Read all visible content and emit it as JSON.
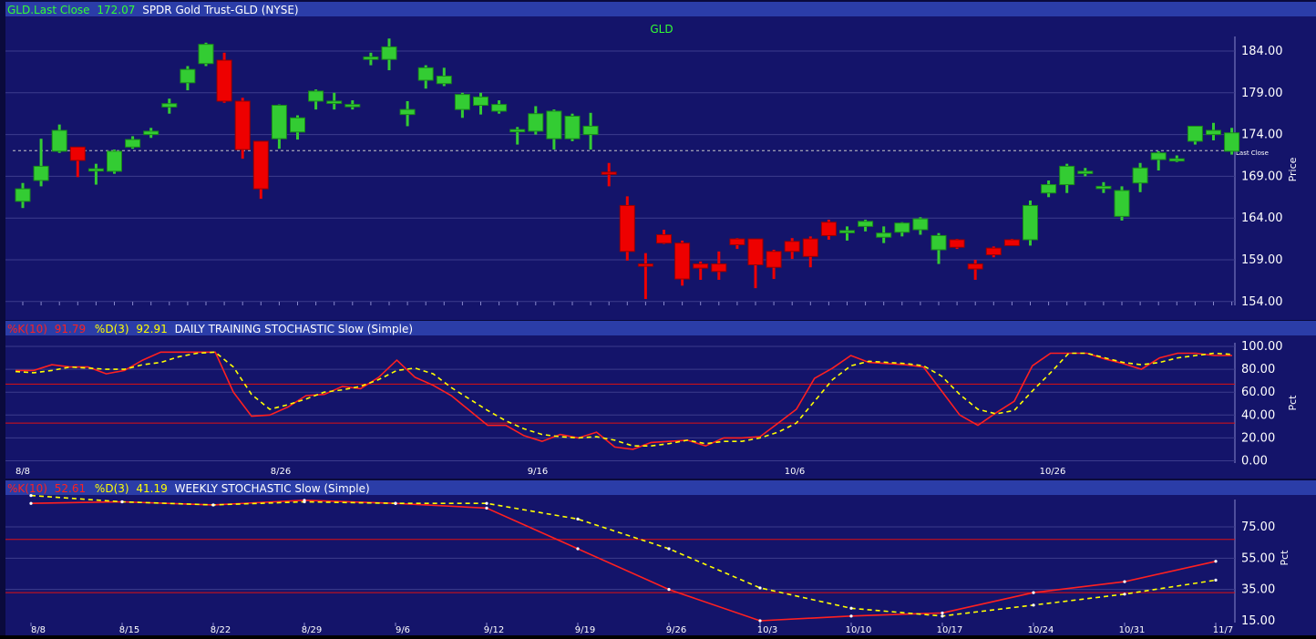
{
  "colors": {
    "panel_bg": "#14146a",
    "header_bg": "#2b3da8",
    "grid": "#3c3c8c",
    "up": "#33cc33",
    "down": "#ee0000",
    "k_line": "#ff2020",
    "d_line": "#ffff00",
    "text": "#ffffff",
    "green_text": "#33ff33"
  },
  "price_panel": {
    "header_ticker_label": "GLD.Last Close",
    "header_last_close": "172.07",
    "header_title": "SPDR Gold Trust-GLD (NYSE)",
    "center_label": "GLD",
    "ylabel": "Price",
    "last_close_tag": "Last Close",
    "yticks": [
      "184.00",
      "179.00",
      "174.00",
      "169.00",
      "164.00",
      "159.00",
      "154.00"
    ]
  },
  "daily_panel": {
    "k_label": "%K(10)",
    "k_value": "91.79",
    "d_label": "%D(3)",
    "d_value": "92.91",
    "title": "DAILY TRAINING STOCHASTIC Slow (Simple)",
    "ylabel": "Pct",
    "yticks": [
      "100.00",
      "80.00",
      "60.00",
      "40.00",
      "20.00",
      "0.00"
    ],
    "xticks": [
      "8/8",
      "8/26",
      "9/16",
      "10/6",
      "10/26"
    ]
  },
  "weekly_panel": {
    "k_label": "%K(10)",
    "k_value": "52.61",
    "d_label": "%D(3)",
    "d_value": "41.19",
    "title": "WEEKLY STOCHASTIC Slow (Simple)",
    "ylabel": "Pct",
    "yticks": [
      "75.00",
      "55.00",
      "35.00",
      "15.00"
    ],
    "xticks": [
      "8/8",
      "8/15",
      "8/22",
      "8/29",
      "9/6",
      "9/12",
      "9/19",
      "9/26",
      "10/3",
      "10/10",
      "10/17",
      "10/24",
      "10/31",
      "11/7"
    ]
  },
  "chart_data": [
    {
      "type": "candlestick",
      "title": "GLD",
      "ylabel": "Price",
      "ylim": [
        154,
        186
      ],
      "last_close": 172.07,
      "candles": [
        {
          "o": 166.0,
          "h": 168.2,
          "l": 165.2,
          "c": 167.5
        },
        {
          "o": 168.5,
          "h": 173.5,
          "l": 167.8,
          "c": 170.2
        },
        {
          "o": 172.0,
          "h": 175.2,
          "l": 171.8,
          "c": 174.5
        },
        {
          "o": 172.5,
          "h": 172.5,
          "l": 168.9,
          "c": 170.9
        },
        {
          "o": 169.9,
          "h": 170.5,
          "l": 168.0,
          "c": 169.9
        },
        {
          "o": 169.6,
          "h": 172.2,
          "l": 169.3,
          "c": 172.0
        },
        {
          "o": 172.5,
          "h": 173.8,
          "l": 172.3,
          "c": 173.4
        },
        {
          "o": 174.0,
          "h": 174.8,
          "l": 173.6,
          "c": 174.4
        },
        {
          "o": 177.3,
          "h": 178.3,
          "l": 176.5,
          "c": 177.7
        },
        {
          "o": 180.2,
          "h": 182.2,
          "l": 179.3,
          "c": 181.8
        },
        {
          "o": 182.5,
          "h": 185.0,
          "l": 182.2,
          "c": 184.8
        },
        {
          "o": 182.9,
          "h": 183.8,
          "l": 177.8,
          "c": 178.0
        },
        {
          "o": 178.0,
          "h": 178.4,
          "l": 171.1,
          "c": 172.2
        },
        {
          "o": 173.2,
          "h": 173.2,
          "l": 166.3,
          "c": 167.5
        },
        {
          "o": 173.5,
          "h": 177.6,
          "l": 172.3,
          "c": 177.5
        },
        {
          "o": 174.3,
          "h": 176.3,
          "l": 173.4,
          "c": 176.0
        },
        {
          "o": 178.0,
          "h": 179.4,
          "l": 177.0,
          "c": 179.2
        },
        {
          "o": 178.0,
          "h": 179.0,
          "l": 177.0,
          "c": 178.0
        },
        {
          "o": 177.5,
          "h": 178.1,
          "l": 177.0,
          "c": 177.6
        },
        {
          "o": 183.0,
          "h": 183.8,
          "l": 182.3,
          "c": 183.3
        },
        {
          "o": 183.0,
          "h": 185.5,
          "l": 181.7,
          "c": 184.5
        },
        {
          "o": 176.4,
          "h": 178.0,
          "l": 175.0,
          "c": 177.0
        },
        {
          "o": 180.5,
          "h": 182.3,
          "l": 179.5,
          "c": 182.0
        },
        {
          "o": 180.1,
          "h": 182.0,
          "l": 179.8,
          "c": 181.0
        },
        {
          "o": 177.0,
          "h": 179.0,
          "l": 176.0,
          "c": 178.8
        },
        {
          "o": 177.5,
          "h": 179.0,
          "l": 176.4,
          "c": 178.5
        },
        {
          "o": 176.8,
          "h": 178.1,
          "l": 176.5,
          "c": 177.6
        },
        {
          "o": 174.6,
          "h": 174.9,
          "l": 172.8,
          "c": 174.6
        },
        {
          "o": 174.4,
          "h": 177.4,
          "l": 174.0,
          "c": 176.5
        },
        {
          "o": 173.5,
          "h": 177.0,
          "l": 172.2,
          "c": 176.8
        },
        {
          "o": 173.5,
          "h": 176.5,
          "l": 173.2,
          "c": 176.2
        },
        {
          "o": 174.0,
          "h": 176.6,
          "l": 172.2,
          "c": 175.0
        },
        {
          "o": 169.5,
          "h": 170.6,
          "l": 167.8,
          "c": 169.4
        },
        {
          "o": 165.5,
          "h": 166.6,
          "l": 158.9,
          "c": 160.0
        },
        {
          "o": 158.5,
          "h": 159.8,
          "l": 154.3,
          "c": 158.3
        },
        {
          "o": 162.0,
          "h": 162.6,
          "l": 160.9,
          "c": 161.0
        },
        {
          "o": 161.0,
          "h": 161.3,
          "l": 155.9,
          "c": 156.7
        },
        {
          "o": 158.5,
          "h": 158.8,
          "l": 156.6,
          "c": 158.0
        },
        {
          "o": 158.5,
          "h": 160.0,
          "l": 156.6,
          "c": 157.6
        },
        {
          "o": 161.5,
          "h": 161.6,
          "l": 160.3,
          "c": 160.8
        },
        {
          "o": 161.5,
          "h": 161.5,
          "l": 155.6,
          "c": 158.4
        },
        {
          "o": 160.0,
          "h": 160.2,
          "l": 156.7,
          "c": 158.1
        },
        {
          "o": 161.2,
          "h": 161.6,
          "l": 159.1,
          "c": 160.0
        },
        {
          "o": 161.5,
          "h": 161.8,
          "l": 158.1,
          "c": 159.4
        },
        {
          "o": 163.5,
          "h": 163.8,
          "l": 161.4,
          "c": 161.9
        },
        {
          "o": 162.3,
          "h": 163.0,
          "l": 161.3,
          "c": 162.5
        },
        {
          "o": 163.0,
          "h": 163.8,
          "l": 162.4,
          "c": 163.6
        },
        {
          "o": 161.7,
          "h": 163.0,
          "l": 161.0,
          "c": 162.2
        },
        {
          "o": 162.3,
          "h": 163.5,
          "l": 161.8,
          "c": 163.4
        },
        {
          "o": 162.6,
          "h": 164.1,
          "l": 162.0,
          "c": 163.9
        },
        {
          "o": 160.2,
          "h": 162.2,
          "l": 158.5,
          "c": 161.9
        },
        {
          "o": 161.4,
          "h": 161.5,
          "l": 160.3,
          "c": 160.5
        },
        {
          "o": 158.5,
          "h": 159.0,
          "l": 156.6,
          "c": 157.9
        },
        {
          "o": 160.4,
          "h": 160.6,
          "l": 159.3,
          "c": 159.6
        },
        {
          "o": 161.4,
          "h": 161.5,
          "l": 160.7,
          "c": 160.7
        },
        {
          "o": 161.4,
          "h": 166.1,
          "l": 160.7,
          "c": 165.5
        },
        {
          "o": 167.0,
          "h": 168.5,
          "l": 166.5,
          "c": 168.0
        },
        {
          "o": 168.0,
          "h": 170.5,
          "l": 167.0,
          "c": 170.2
        },
        {
          "o": 169.5,
          "h": 170.0,
          "l": 169.0,
          "c": 169.6
        },
        {
          "o": 167.6,
          "h": 168.3,
          "l": 167.0,
          "c": 167.8
        },
        {
          "o": 164.2,
          "h": 167.8,
          "l": 163.7,
          "c": 167.3
        },
        {
          "o": 168.2,
          "h": 170.6,
          "l": 167.1,
          "c": 170.0
        },
        {
          "o": 171.0,
          "h": 172.0,
          "l": 169.7,
          "c": 171.8
        },
        {
          "o": 171.0,
          "h": 171.5,
          "l": 170.7,
          "c": 171.1
        },
        {
          "o": 173.2,
          "h": 175.0,
          "l": 172.8,
          "c": 175.0
        },
        {
          "o": 174.0,
          "h": 175.4,
          "l": 173.3,
          "c": 174.5
        },
        {
          "o": 172.0,
          "h": 174.8,
          "l": 171.6,
          "c": 174.2
        }
      ]
    },
    {
      "type": "line",
      "title": "DAILY TRAINING STOCHASTIC Slow (Simple)",
      "ylabel": "Pct",
      "ylim": [
        0,
        100
      ],
      "reference_lines": [
        33,
        67
      ],
      "series": [
        {
          "name": "%K(10)",
          "values": [
            79,
            79,
            84,
            82,
            82,
            76,
            79,
            88,
            95,
            95,
            95,
            95,
            60,
            39,
            40,
            47,
            57,
            58,
            65,
            63,
            73,
            88,
            73,
            66,
            57,
            44,
            31,
            31,
            22,
            17,
            23,
            20,
            25,
            12,
            10,
            16,
            17,
            18,
            13,
            20,
            20,
            21,
            33,
            45,
            72,
            81,
            92,
            86,
            85,
            84,
            82,
            61,
            40,
            31,
            42,
            52,
            83,
            94,
            94,
            94,
            89,
            85,
            80,
            90,
            94,
            94,
            92,
            92
          ]
        },
        {
          "name": "%D(3)",
          "values": [
            78,
            77,
            79,
            82,
            81,
            80,
            80,
            84,
            86,
            91,
            94,
            95,
            82,
            58,
            45,
            49,
            54,
            60,
            62,
            65,
            71,
            79,
            81,
            76,
            64,
            54,
            44,
            35,
            28,
            23,
            21,
            20,
            21,
            18,
            13,
            13,
            15,
            18,
            15,
            17,
            17,
            20,
            25,
            33,
            52,
            71,
            83,
            87,
            86,
            85,
            83,
            74,
            58,
            45,
            41,
            44,
            61,
            77,
            94,
            94,
            90,
            86,
            84,
            86,
            90,
            92,
            94,
            93
          ]
        }
      ]
    },
    {
      "type": "line",
      "title": "WEEKLY STOCHASTIC Slow (Simple)",
      "ylabel": "Pct",
      "ylim": [
        15,
        95
      ],
      "categories": [
        "8/8",
        "8/15",
        "8/22",
        "8/29",
        "9/6",
        "9/12",
        "9/19",
        "9/26",
        "10/3",
        "10/10",
        "10/17",
        "10/24",
        "10/31",
        "11/7"
      ],
      "reference_lines": [
        33,
        67
      ],
      "series": [
        {
          "name": "%K(10)",
          "values": [
            90,
            91,
            89,
            92,
            90,
            87,
            61,
            35,
            15,
            18,
            20,
            33,
            40,
            53
          ]
        },
        {
          "name": "%D(3)",
          "values": [
            95,
            91,
            89,
            91,
            90,
            90,
            80,
            61,
            36,
            23,
            18,
            25,
            32,
            41
          ]
        }
      ]
    }
  ]
}
